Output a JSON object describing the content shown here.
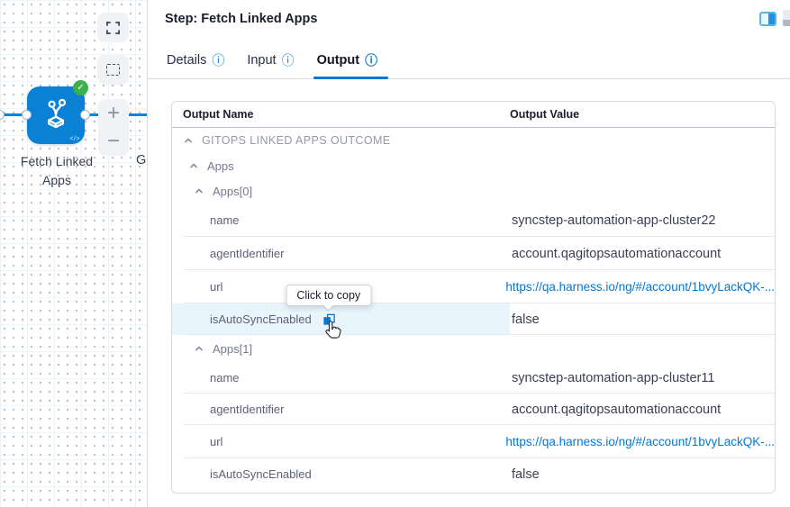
{
  "canvas": {
    "node_label_line1": "Fetch Linked",
    "node_label_line2": "Apps",
    "next_node_label_cut": "G",
    "badge_check": "✓",
    "code_glyph": "</>",
    "zoom_in_label": "+",
    "zoom_out_label": "−",
    "node_color": "#0b81d6",
    "badge_color": "#3cb14a",
    "edge_color": "#0b84da"
  },
  "panel": {
    "title": "Step: Fetch Linked Apps",
    "info_icon": "ⓘ",
    "accent_color": "#0278d5",
    "tabs": [
      {
        "label": "Details",
        "active": false
      },
      {
        "label": "Input",
        "active": false
      },
      {
        "label": "Output",
        "active": true
      }
    ]
  },
  "table": {
    "columns": [
      "Output Name",
      "Output Value"
    ],
    "tooltip": "Click to copy",
    "link_color": "#0278d5",
    "highlight_color": "#e9f5fc",
    "rows": [
      {
        "type": "group",
        "level": 0,
        "label": "GITOPS LINKED APPS OUTCOME"
      },
      {
        "type": "group",
        "level": 1,
        "label": "Apps"
      },
      {
        "type": "group",
        "level": 2,
        "label": "Apps[0]"
      },
      {
        "type": "data",
        "key": "name",
        "value": "syncstep-automation-app-cluster22"
      },
      {
        "type": "data",
        "key": "agentIdentifier",
        "value": "account.qagitopsautomationaccount"
      },
      {
        "type": "data",
        "key": "url",
        "value": "https://qa.harness.io/ng/#/account/1bvyLackQK-...",
        "link": true
      },
      {
        "type": "data",
        "key": "isAutoSyncEnabled",
        "value": "false",
        "highlighted": true
      },
      {
        "type": "group",
        "level": 2,
        "label": "Apps[1]"
      },
      {
        "type": "data",
        "key": "name",
        "value": "syncstep-automation-app-cluster11"
      },
      {
        "type": "data",
        "key": "agentIdentifier",
        "value": "account.qagitopsautomationaccount"
      },
      {
        "type": "data",
        "key": "url",
        "value": "https://qa.harness.io/ng/#/account/1bvyLackQK-...",
        "link": true
      },
      {
        "type": "data",
        "key": "isAutoSyncEnabled",
        "value": "false"
      }
    ]
  }
}
